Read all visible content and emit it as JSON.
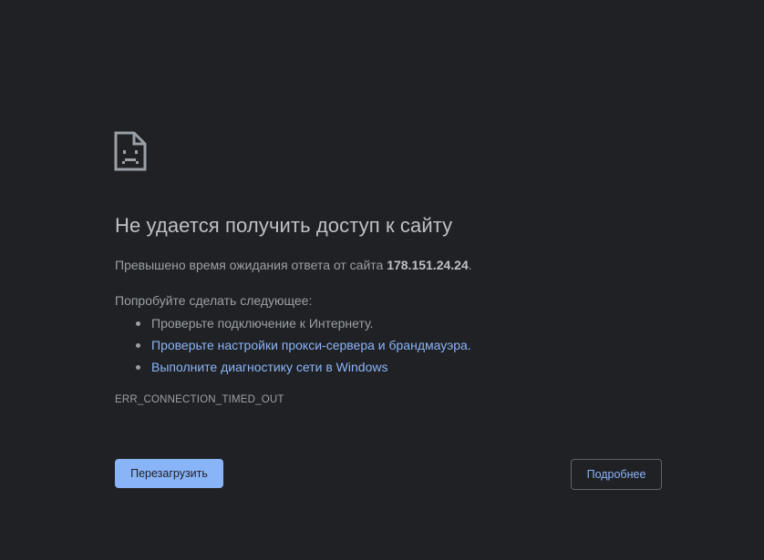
{
  "error": {
    "icon": "sad-page-icon",
    "title": "Не удается получить доступ к сайту",
    "summary_prefix": "Превышено время ожидания ответа от сайта ",
    "host": "178.151.24.24",
    "summary_suffix": ".",
    "suggestions_heading": "Попробуйте сделать следующее:",
    "suggestions": [
      {
        "label": "Проверьте подключение к Интернету.",
        "link": false
      },
      {
        "label": "Проверьте настройки прокси-сервера и брандмауэра.",
        "link": true
      },
      {
        "label": "Выполните диагностику сети в Windows",
        "link": true
      }
    ],
    "code": "ERR_CONNECTION_TIMED_OUT"
  },
  "buttons": {
    "reload_label": "Перезагрузить",
    "details_label": "Подробнее"
  },
  "colors": {
    "background": "#202124",
    "text_primary": "#bdc1c6",
    "text_secondary": "#9aa0a6",
    "accent": "#8ab4f8"
  }
}
